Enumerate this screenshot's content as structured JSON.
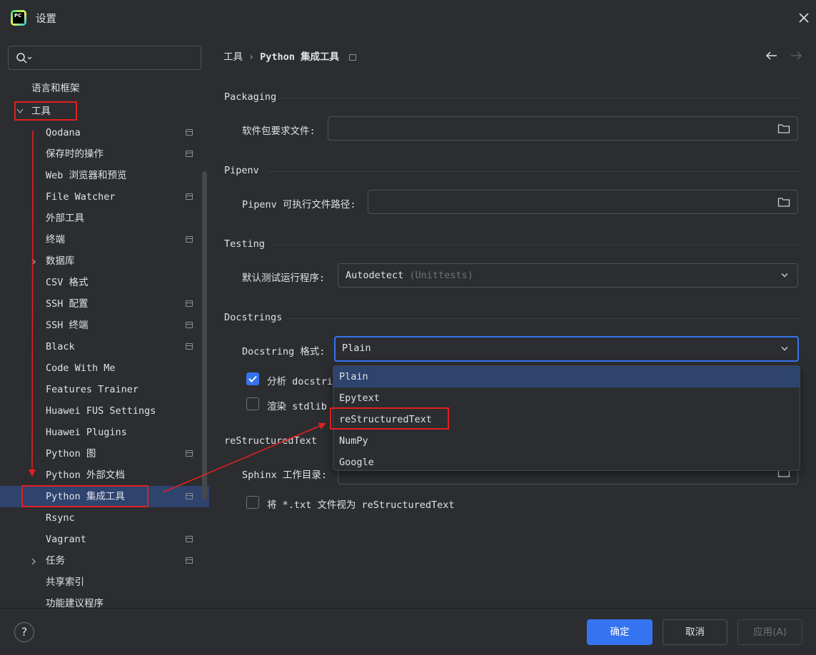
{
  "window": {
    "title": "设置"
  },
  "sidebar": {
    "search_placeholder": "",
    "items": [
      {
        "label": "语言和框架"
      },
      {
        "label": "工具"
      },
      {
        "label": "Qodana"
      },
      {
        "label": "保存时的操作"
      },
      {
        "label": "Web 浏览器和预览"
      },
      {
        "label": "File Watcher"
      },
      {
        "label": "外部工具"
      },
      {
        "label": "终端"
      },
      {
        "label": "数据库"
      },
      {
        "label": "CSV 格式"
      },
      {
        "label": "SSH 配置"
      },
      {
        "label": "SSH 终端"
      },
      {
        "label": "Black"
      },
      {
        "label": "Code With Me"
      },
      {
        "label": "Features Trainer"
      },
      {
        "label": "Huawei FUS Settings"
      },
      {
        "label": "Huawei Plugins"
      },
      {
        "label": "Python 图"
      },
      {
        "label": "Python 外部文档"
      },
      {
        "label": "Python 集成工具"
      },
      {
        "label": "Rsync"
      },
      {
        "label": "Vagrant"
      },
      {
        "label": "任务"
      },
      {
        "label": "共享索引"
      },
      {
        "label": "功能建议程序"
      }
    ]
  },
  "breadcrumb": {
    "parent": "工具",
    "sep": "›",
    "current": "Python 集成工具"
  },
  "packaging": {
    "title": "Packaging",
    "req_label": "软件包要求文件:",
    "req_value": ""
  },
  "pipenv": {
    "title": "Pipenv",
    "path_label": "Pipenv 可执行文件路径:",
    "path_value": ""
  },
  "testing": {
    "title": "Testing",
    "runner_label": "默认测试运行程序:",
    "runner_value": "Autodetect",
    "runner_hint": "(Unittests)"
  },
  "docstrings": {
    "title": "Docstrings",
    "format_label": "Docstring 格式:",
    "format_value": "Plain",
    "analyze_label": "分析 docstri",
    "analyze_checked": true,
    "render_label": "渲染 stdlib",
    "render_checked": false,
    "options": [
      "Plain",
      "Epytext",
      "reStructuredText",
      "NumPy",
      "Google"
    ]
  },
  "rst": {
    "title": "reStructuredText",
    "sphinx_label": "Sphinx 工作目录:",
    "txt_label": "将 *.txt 文件视为 reStructuredText",
    "txt_checked": false
  },
  "footer": {
    "help": "?",
    "ok": "确定",
    "cancel": "取消",
    "apply": "应用(A)"
  },
  "colors": {
    "accent": "#3574f0",
    "annotation": "#e02020",
    "selection": "#2e436e"
  }
}
